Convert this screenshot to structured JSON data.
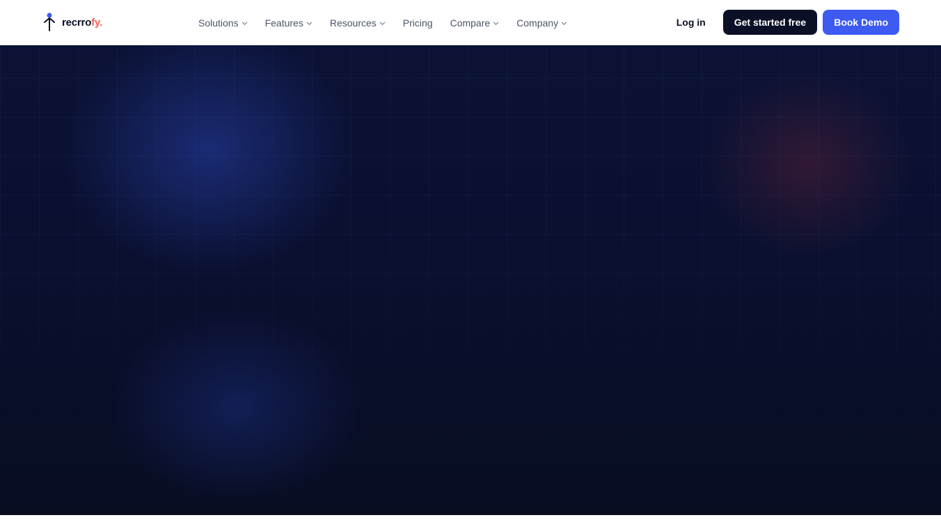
{
  "brand": {
    "name_main": "recrro",
    "name_accent": "fy.",
    "accent_color": "#f0615b",
    "mark_color": "#3d5af1"
  },
  "nav": {
    "items": [
      {
        "label": "Solutions",
        "has_dropdown": true
      },
      {
        "label": "Features",
        "has_dropdown": true
      },
      {
        "label": "Resources",
        "has_dropdown": true
      },
      {
        "label": "Pricing",
        "has_dropdown": false
      },
      {
        "label": "Compare",
        "has_dropdown": true
      },
      {
        "label": "Company",
        "has_dropdown": true
      }
    ],
    "dropdown_icon": "chevron-down-icon"
  },
  "actions": {
    "login_label": "Log in",
    "get_started_label": "Get started free",
    "book_demo_label": "Book Demo"
  },
  "colors": {
    "dark": "#0b1026",
    "primary_blue": "#3d5af1",
    "hero_background": "#0a1030"
  }
}
